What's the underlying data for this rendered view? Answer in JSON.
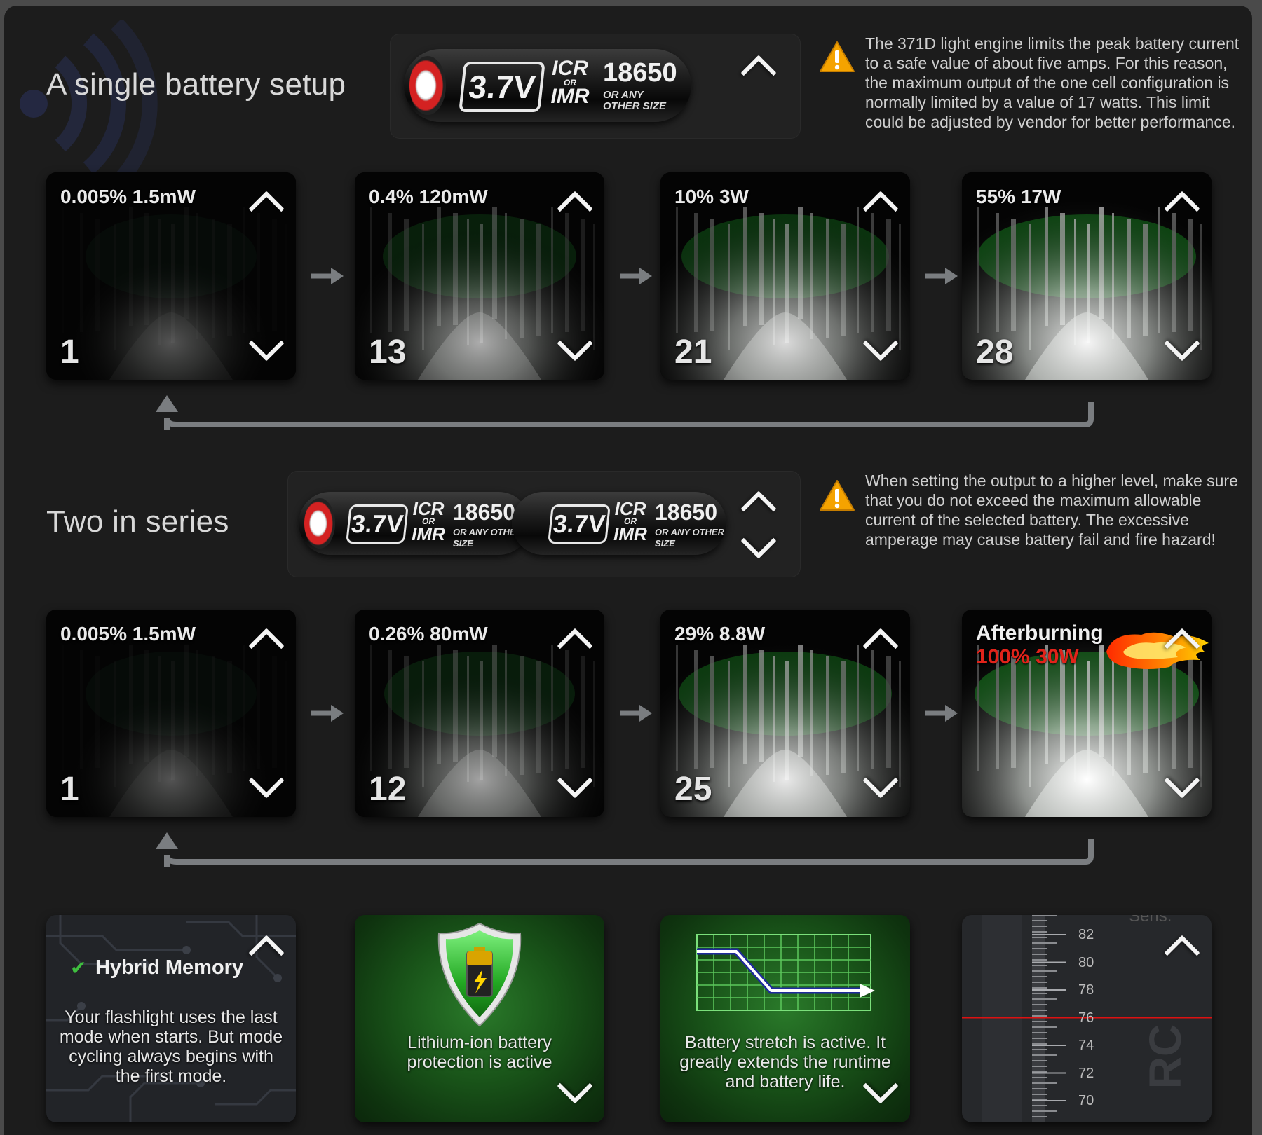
{
  "single": {
    "title": "A single battery setup",
    "battery": {
      "voltage": "3.7V",
      "chem_top": "ICR",
      "chem_or": "OR",
      "chem_bottom": "IMR",
      "size": "18650",
      "other": "OR ANY OTHER SIZE"
    },
    "warning": "The 371D light engine limits the peak battery current to a safe value of about five amps. For this reason, the maximum output of the one cell configuration is normally limited by a value of 17 watts. This limit could be adjusted by vendor for better performance.",
    "modes": [
      {
        "label": "0.005% 1.5mW",
        "number": "1",
        "brightness": 0.05
      },
      {
        "label": "0.4% 120mW",
        "number": "13",
        "brightness": 0.45
      },
      {
        "label": "10% 3W",
        "number": "21",
        "brightness": 0.7
      },
      {
        "label": "55% 17W",
        "number": "28",
        "brightness": 0.9
      }
    ]
  },
  "series": {
    "title": "Two in series",
    "battery": {
      "voltage": "3.7V",
      "chem_top": "ICR",
      "chem_or": "OR",
      "chem_bottom": "IMR",
      "size": "18650",
      "other": "OR ANY OTHER SIZE"
    },
    "warning": "When setting the output to a higher level, make sure that you do not exceed the maximum allowable current of the selected battery. The excessive amperage may cause battery fail and fire hazard!",
    "modes": [
      {
        "label": "0.005% 1.5mW",
        "number": "1",
        "brightness": 0.05
      },
      {
        "label": "0.26% 80mW",
        "number": "12",
        "brightness": 0.4
      },
      {
        "label": "29% 8.8W",
        "number": "25",
        "brightness": 0.8
      }
    ],
    "afterburning": {
      "title": "Afterburning",
      "label": "100% 30W",
      "brightness": 1.0
    }
  },
  "features": {
    "memory": {
      "title": "Hybrid Memory",
      "text": "Your flashlight uses the last mode when starts. But mode cycling always begins with the first mode."
    },
    "protection": {
      "text": "Lithium-ion battery protection is active"
    },
    "stretch": {
      "text": "Battery stretch is active. It greatly extends the runtime and battery life."
    },
    "ruler": {
      "top_label": "Sens.",
      "ticks": [
        "82",
        "80",
        "78",
        "76",
        "74",
        "72",
        "70"
      ],
      "marker_value": 76,
      "watermark": "RC"
    }
  },
  "colors": {
    "background": "#1c1c1c",
    "warning": "#f5a300",
    "afterburn_red": "#e2231a",
    "tile_green": "#195419"
  },
  "icons": [
    "warning-icon",
    "chevron-up-icon",
    "chevron-down-icon",
    "arrow-right-icon",
    "loop-arrow-icon",
    "battery-shield-icon",
    "stretch-graph-icon",
    "flame-icon",
    "check-icon"
  ]
}
